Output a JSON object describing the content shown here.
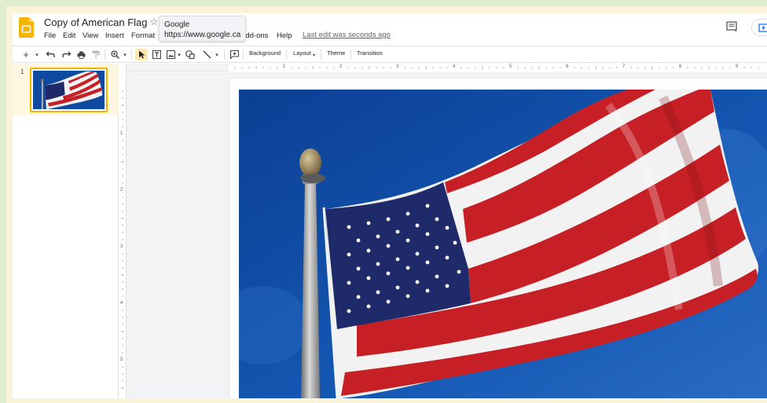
{
  "app": {
    "title": "Copy of American Flag",
    "last_edit": "Last edit was seconds ago"
  },
  "menu": [
    "File",
    "Edit",
    "View",
    "Insert",
    "Format",
    "Add-ons",
    "Help"
  ],
  "tooltip": {
    "title": "Google",
    "url": "https://www.google.ca"
  },
  "toolbar": {
    "background_label": "Background",
    "layout_label": "Layout",
    "theme_label": "Theme",
    "transition_label": "Transition"
  },
  "filmstrip": {
    "slides": [
      {
        "number": "1"
      }
    ]
  },
  "ruler": {
    "horizontal": [
      "1",
      "2",
      "3",
      "4",
      "5",
      "6",
      "7",
      "8",
      "9"
    ],
    "vertical": [
      "1",
      "2",
      "3",
      "4",
      "5"
    ]
  },
  "colors": {
    "logo": "#f4b400",
    "sky": "#0d4aa0",
    "flag_red": "#c62026",
    "flag_white": "#f3f3f3",
    "flag_blue": "#1f2a6b",
    "pole": "#a9a9a9"
  }
}
